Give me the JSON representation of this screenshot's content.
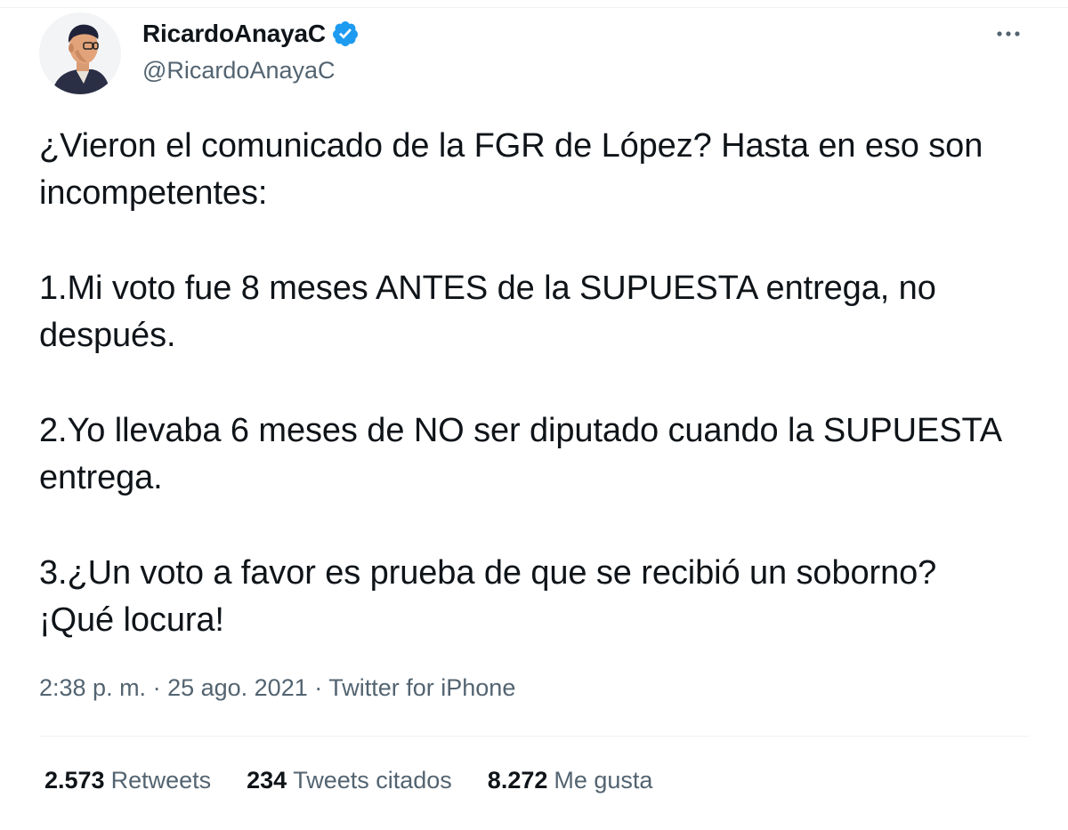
{
  "author": {
    "display_name": "RicardoAnayaC",
    "handle": "@RicardoAnayaC",
    "verified": true,
    "verified_icon": "verified-badge-icon",
    "avatar_icon": "profile-avatar"
  },
  "menu": {
    "more_icon": "more-horizontal-icon",
    "label": "···"
  },
  "tweet": {
    "paragraphs": [
      "¿Vieron el comunicado de la FGR de López? Hasta en eso son incompetentes:",
      "1.Mi voto fue 8 meses ANTES de la SUPUESTA entrega, no después.",
      "2.Yo llevaba 6 meses de NO ser diputado cuando la SUPUESTA entrega.",
      "3.¿Un voto a favor es prueba de que se recibió un soborno? ¡Qué locura!"
    ]
  },
  "meta": {
    "time": "2:38 p. m.",
    "sep1": " · ",
    "date": "25 ago. 2021",
    "sep2": " · ",
    "source": "Twitter for iPhone"
  },
  "stats": {
    "retweets_count": "2.573",
    "retweets_label": "Retweets",
    "quotes_count": "234",
    "quotes_label": "Tweets citados",
    "likes_count": "8.272",
    "likes_label": "Me gusta"
  },
  "colors": {
    "primary_text": "#0f1419",
    "secondary_text": "#536471",
    "verified_blue": "#1d9bf0",
    "divider": "#eff3f4"
  }
}
